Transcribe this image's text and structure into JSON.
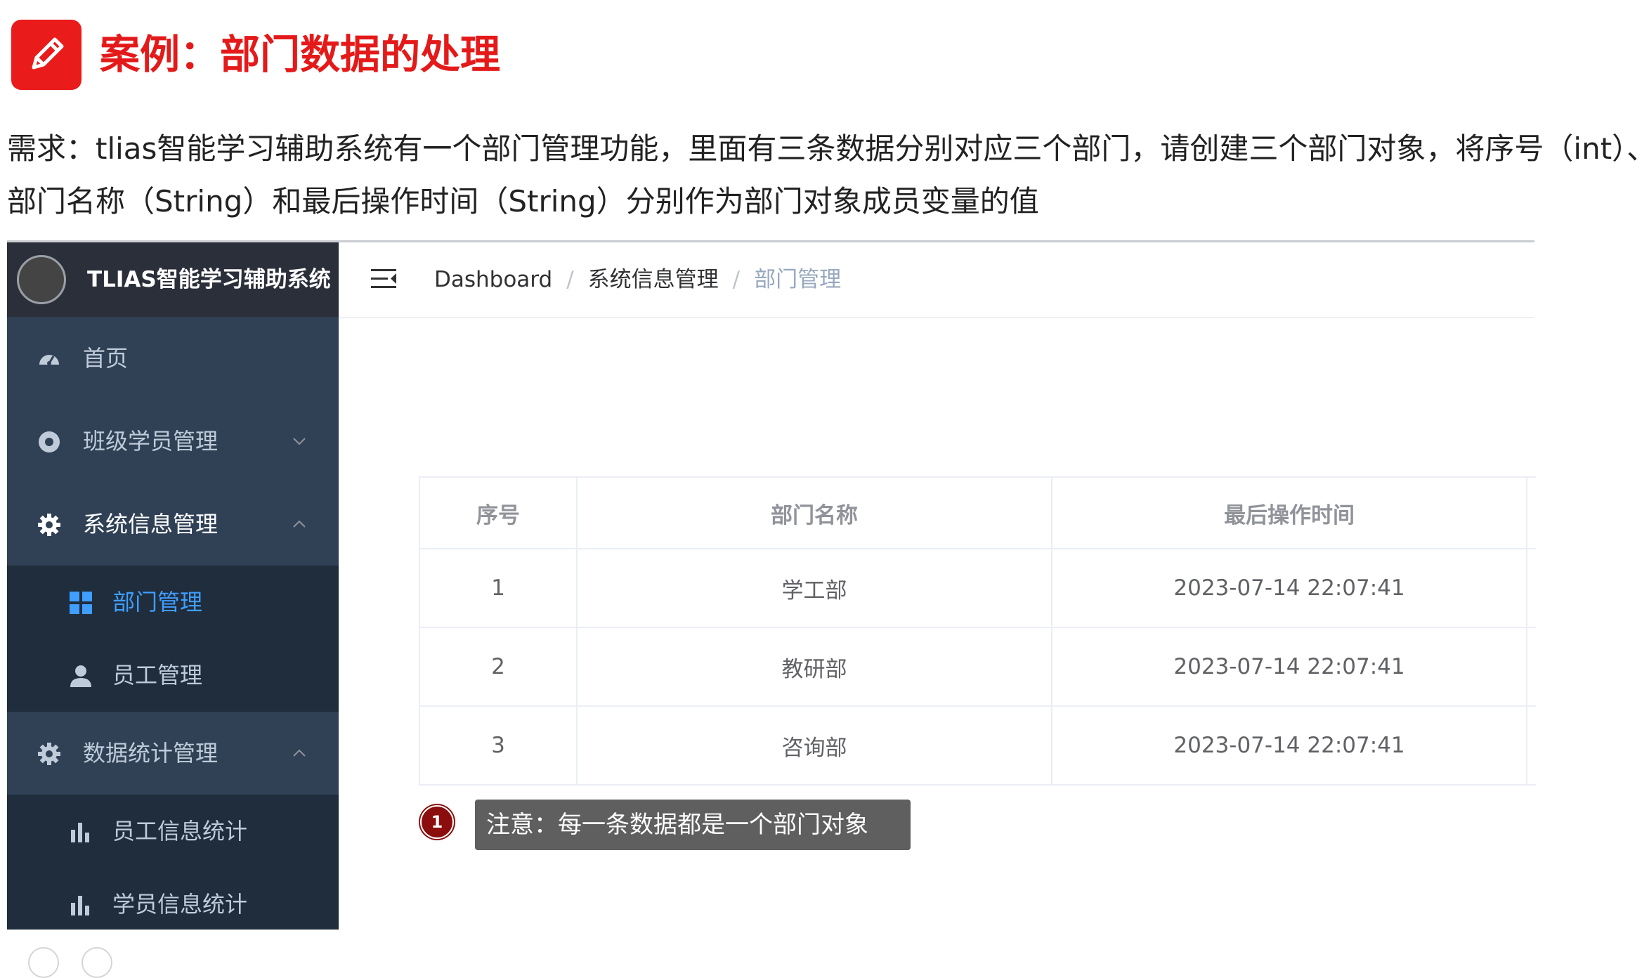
{
  "slide": {
    "title": "案例：部门数据的处理",
    "description_line1": "需求：tlias智能学习辅助系统有一个部门管理功能，里面有三条数据分别对应三个部门，请创建三个部门对象，将序号（int）、",
    "description_line2": "部门名称（String）和最后操作时间（String）分别作为部门对象成员变量的值",
    "note_number": "1",
    "note_text": "注意：每一条数据都是一个部门对象"
  },
  "app": {
    "logo_text": "TLIAS智能学习辅助系统",
    "menu": {
      "home": "首页",
      "class_student": "班级学员管理",
      "system_info": "系统信息管理",
      "dept_manage": "部门管理",
      "employee_manage": "员工管理",
      "data_stats": "数据统计管理",
      "employee_stats": "员工信息统计",
      "student_stats": "学员信息统计"
    },
    "breadcrumb": {
      "item1": "Dashboard",
      "separator": "/",
      "item2": "系统信息管理",
      "item3": "部门管理"
    },
    "table": {
      "headers": [
        "序号",
        "部门名称",
        "最后操作时间"
      ],
      "rows": [
        [
          "1",
          "学工部",
          "2023-07-14 22:07:41"
        ],
        [
          "2",
          "教研部",
          "2023-07-14 22:07:41"
        ],
        [
          "3",
          "咨询部",
          "2023-07-14 22:07:41"
        ]
      ]
    }
  },
  "colors": {
    "accent_red": "#e41a1a",
    "sidebar_bg": "#304156",
    "submenu_bg": "#1f2d3d",
    "active_blue": "#409eff"
  }
}
